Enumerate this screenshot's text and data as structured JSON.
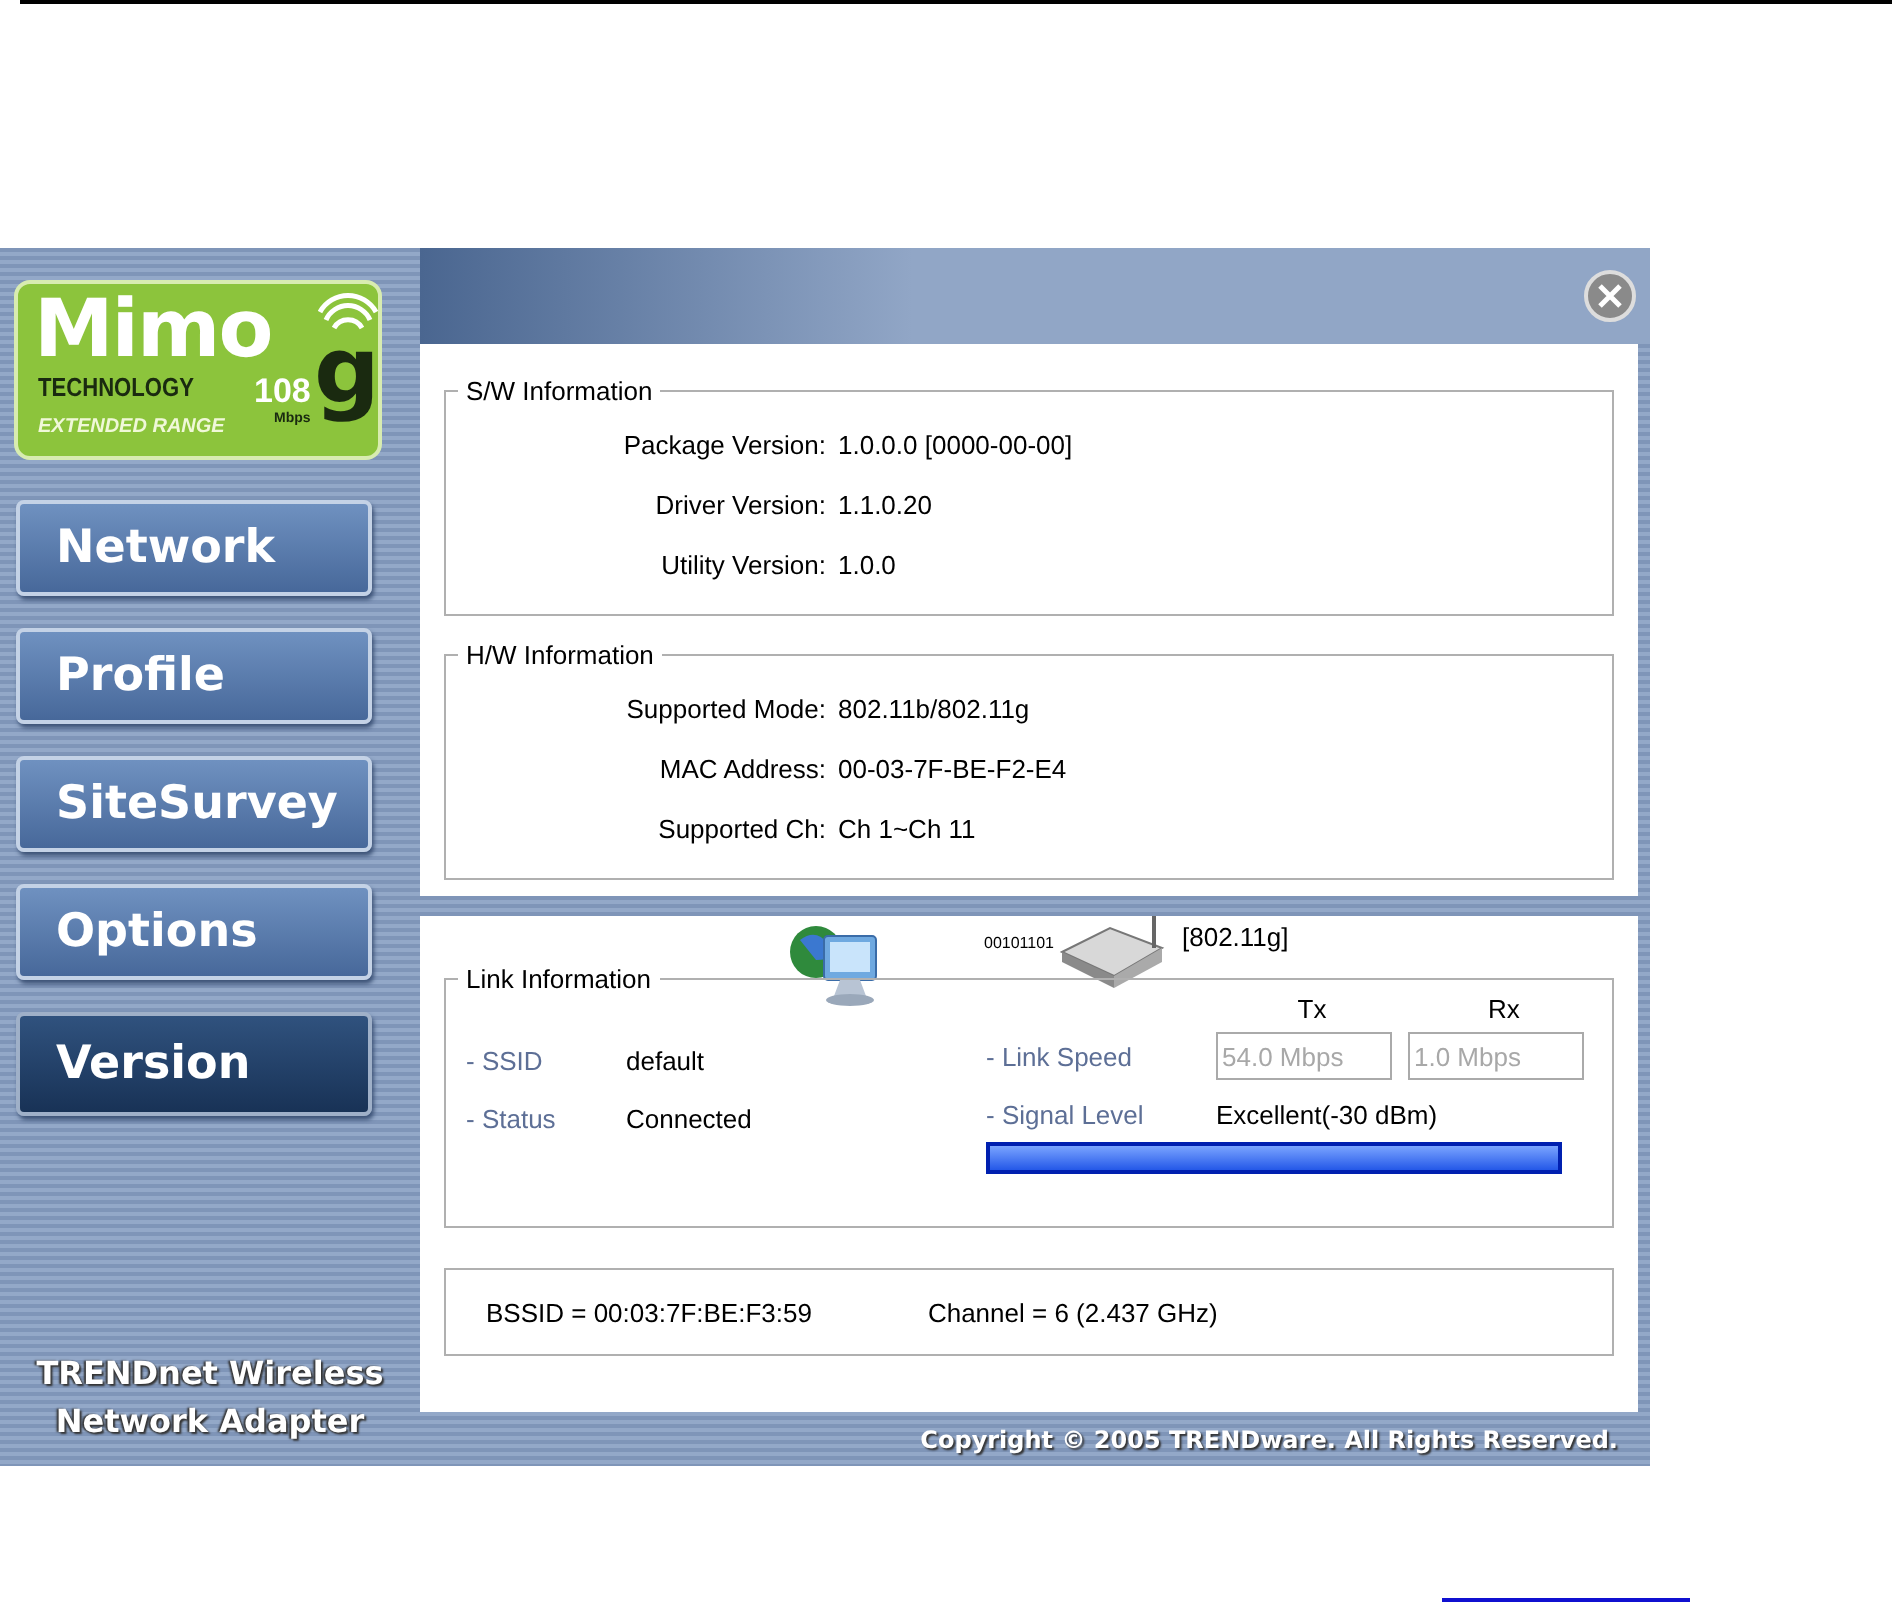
{
  "logo": {
    "brand": "Mimo",
    "technology": "TECHNOLOGY",
    "speed": "108",
    "unit": "Mbps",
    "letter": "g",
    "range": "EXTENDED RANGE"
  },
  "nav": [
    {
      "label": "Network",
      "selected": false
    },
    {
      "label": "Profile",
      "selected": false
    },
    {
      "label": "SiteSurvey",
      "selected": false
    },
    {
      "label": "Options",
      "selected": false
    },
    {
      "label": "Version",
      "selected": true
    }
  ],
  "product_name": [
    "TRENDnet Wireless",
    "Network Adapter"
  ],
  "sw_information": {
    "title": "S/W Information",
    "rows": [
      {
        "label": "Package Version:",
        "value": "1.0.0.0 [0000-00-00]"
      },
      {
        "label": "Driver Version:",
        "value": "1.1.0.20"
      },
      {
        "label": "Utility Version:",
        "value": "1.0.0"
      }
    ]
  },
  "hw_information": {
    "title": "H/W Information",
    "rows": [
      {
        "label": "Supported Mode:",
        "value": "802.11b/802.11g"
      },
      {
        "label": "MAC Address:",
        "value": "00-03-7F-BE-F2-E4"
      },
      {
        "label": "Supported Ch:",
        "value": "Ch 1~Ch 11"
      }
    ]
  },
  "link_information": {
    "title": "Link Information",
    "binary": "00101101",
    "mode": "[802.11g]",
    "ssid": {
      "label": "- SSID",
      "value": "default"
    },
    "status": {
      "label": "- Status",
      "value": "Connected"
    },
    "link_speed": {
      "label": "- Link Speed",
      "tx_header": "Tx",
      "rx_header": "Rx",
      "tx": "54.0 Mbps",
      "rx": "1.0 Mbps",
      "disabled": true
    },
    "signal": {
      "label": "- Signal Level",
      "value": "Excellent(-30 dBm)",
      "level": 1
    }
  },
  "bssid": "BSSID = 00:03:7F:BE:F3:59",
  "channel": "Channel = 6 (2.437 GHz)",
  "copyright": "Copyright © 2005 TRENDware. All Rights Reserved."
}
